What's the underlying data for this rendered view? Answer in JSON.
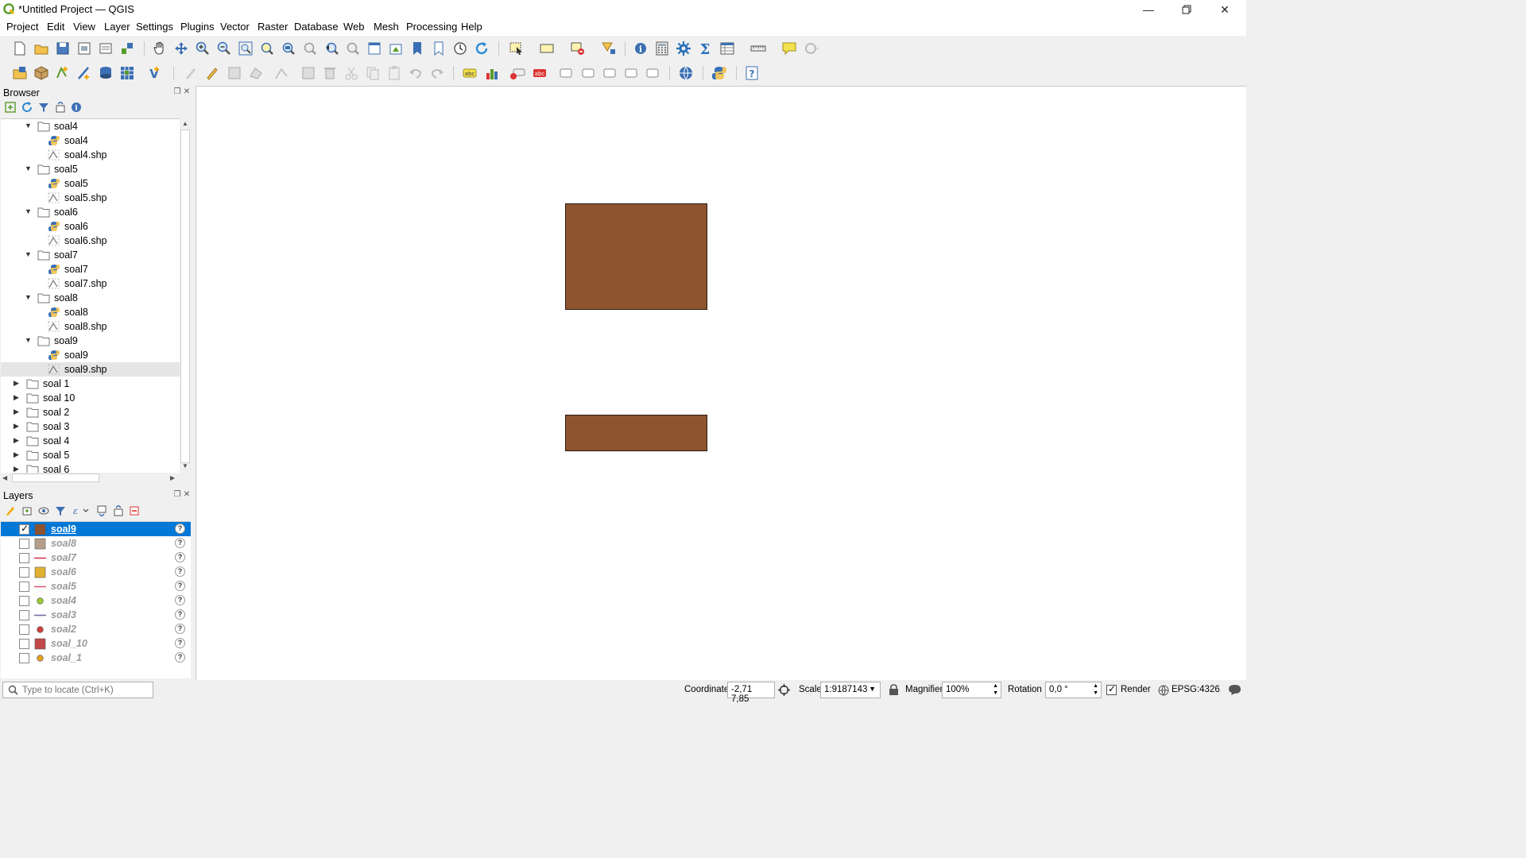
{
  "window": {
    "title": "*Untitled Project — QGIS",
    "controls": [
      "minimize-icon",
      "restore-icon",
      "close-icon"
    ]
  },
  "menu": [
    "Project",
    "Edit",
    "View",
    "Layer",
    "Settings",
    "Plugins",
    "Vector",
    "Raster",
    "Database",
    "Web",
    "Mesh",
    "Processing",
    "Help"
  ],
  "browser": {
    "title": "Browser",
    "tree": [
      {
        "label": "soal4",
        "type": "folder",
        "expanded": true,
        "level": 1
      },
      {
        "label": "soal4",
        "type": "python",
        "level": 2
      },
      {
        "label": "soal4.shp",
        "type": "shp",
        "level": 2
      },
      {
        "label": "soal5",
        "type": "folder",
        "expanded": true,
        "level": 1
      },
      {
        "label": "soal5",
        "type": "python",
        "level": 2
      },
      {
        "label": "soal5.shp",
        "type": "shp",
        "level": 2
      },
      {
        "label": "soal6",
        "type": "folder",
        "expanded": true,
        "level": 1
      },
      {
        "label": "soal6",
        "type": "python",
        "level": 2
      },
      {
        "label": "soal6.shp",
        "type": "shp",
        "level": 2
      },
      {
        "label": "soal7",
        "type": "folder",
        "expanded": true,
        "level": 1
      },
      {
        "label": "soal7",
        "type": "python",
        "level": 2
      },
      {
        "label": "soal7.shp",
        "type": "shp",
        "level": 2
      },
      {
        "label": "soal8",
        "type": "folder",
        "expanded": true,
        "level": 1
      },
      {
        "label": "soal8",
        "type": "python",
        "level": 2
      },
      {
        "label": "soal8.shp",
        "type": "shp",
        "level": 2
      },
      {
        "label": "soal9",
        "type": "folder",
        "expanded": true,
        "level": 1
      },
      {
        "label": "soal9",
        "type": "python",
        "level": 2
      },
      {
        "label": "soal9.shp",
        "type": "shp",
        "level": 2,
        "selected": true
      },
      {
        "label": "soal 1",
        "type": "folder",
        "expanded": false,
        "level": 0
      },
      {
        "label": "soal 10",
        "type": "folder",
        "expanded": false,
        "level": 0
      },
      {
        "label": "soal 2",
        "type": "folder",
        "expanded": false,
        "level": 0
      },
      {
        "label": "soal 3",
        "type": "folder",
        "expanded": false,
        "level": 0
      },
      {
        "label": "soal 4",
        "type": "folder",
        "expanded": false,
        "level": 0
      },
      {
        "label": "soal 5",
        "type": "folder",
        "expanded": false,
        "level": 0
      },
      {
        "label": "soal 6",
        "type": "folder",
        "expanded": false,
        "level": 0
      }
    ]
  },
  "layers": {
    "title": "Layers",
    "items": [
      {
        "label": "soal9",
        "checked": true,
        "selected": true,
        "symbol": "fill",
        "color": "#8e5430"
      },
      {
        "label": "soal8",
        "checked": false,
        "symbol": "fill",
        "color": "#b4a08a"
      },
      {
        "label": "soal7",
        "checked": false,
        "symbol": "line",
        "color": "#d9334a"
      },
      {
        "label": "soal6",
        "checked": false,
        "symbol": "fill",
        "color": "#e0b030"
      },
      {
        "label": "soal5",
        "checked": false,
        "symbol": "line",
        "color": "#e0607a"
      },
      {
        "label": "soal4",
        "checked": false,
        "symbol": "point",
        "color": "#9acd32"
      },
      {
        "label": "soal3",
        "checked": false,
        "symbol": "line",
        "color": "#7a6aa8"
      },
      {
        "label": "soal2",
        "checked": false,
        "symbol": "point",
        "color": "#d04040"
      },
      {
        "label": "soal_10",
        "checked": false,
        "symbol": "fill",
        "color": "#c04848"
      },
      {
        "label": "soal_1",
        "checked": false,
        "symbol": "point",
        "color": "#e8a020"
      }
    ]
  },
  "statusbar": {
    "locator_placeholder": "Type to locate (Ctrl+K)",
    "coordinate_label": "Coordinate",
    "coordinate_value": "-2,71 7,85",
    "scale_label": "Scale",
    "scale_value": "1:9187143",
    "magnifier_label": "Magnifier",
    "magnifier_value": "100%",
    "rotation_label": "Rotation",
    "rotation_value": "0,0 °",
    "render_label": "Render",
    "render_checked": true,
    "crs": "EPSG:4326"
  },
  "colors": {
    "feature_fill": "#8e5430",
    "selection": "#0078d7"
  }
}
